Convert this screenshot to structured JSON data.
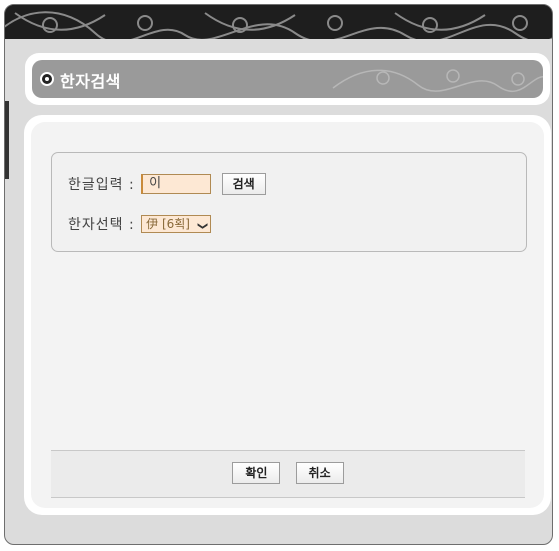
{
  "dialog": {
    "title": "한자검색"
  },
  "form": {
    "hangul_label": "한글입력 :",
    "hangul_value": "이",
    "search_button": "검색",
    "hanja_label": "한자선택 :",
    "hanja_selected": "伊 [6획]"
  },
  "footer": {
    "ok_button": "확인",
    "cancel_button": "취소"
  },
  "colors": {
    "title_bar": "#9a9a9a",
    "input_bg": "#fde8d4",
    "banner": "#222222"
  },
  "icons": [
    "title-bullet-icon",
    "chevron-down-icon",
    "floral-ornament"
  ]
}
